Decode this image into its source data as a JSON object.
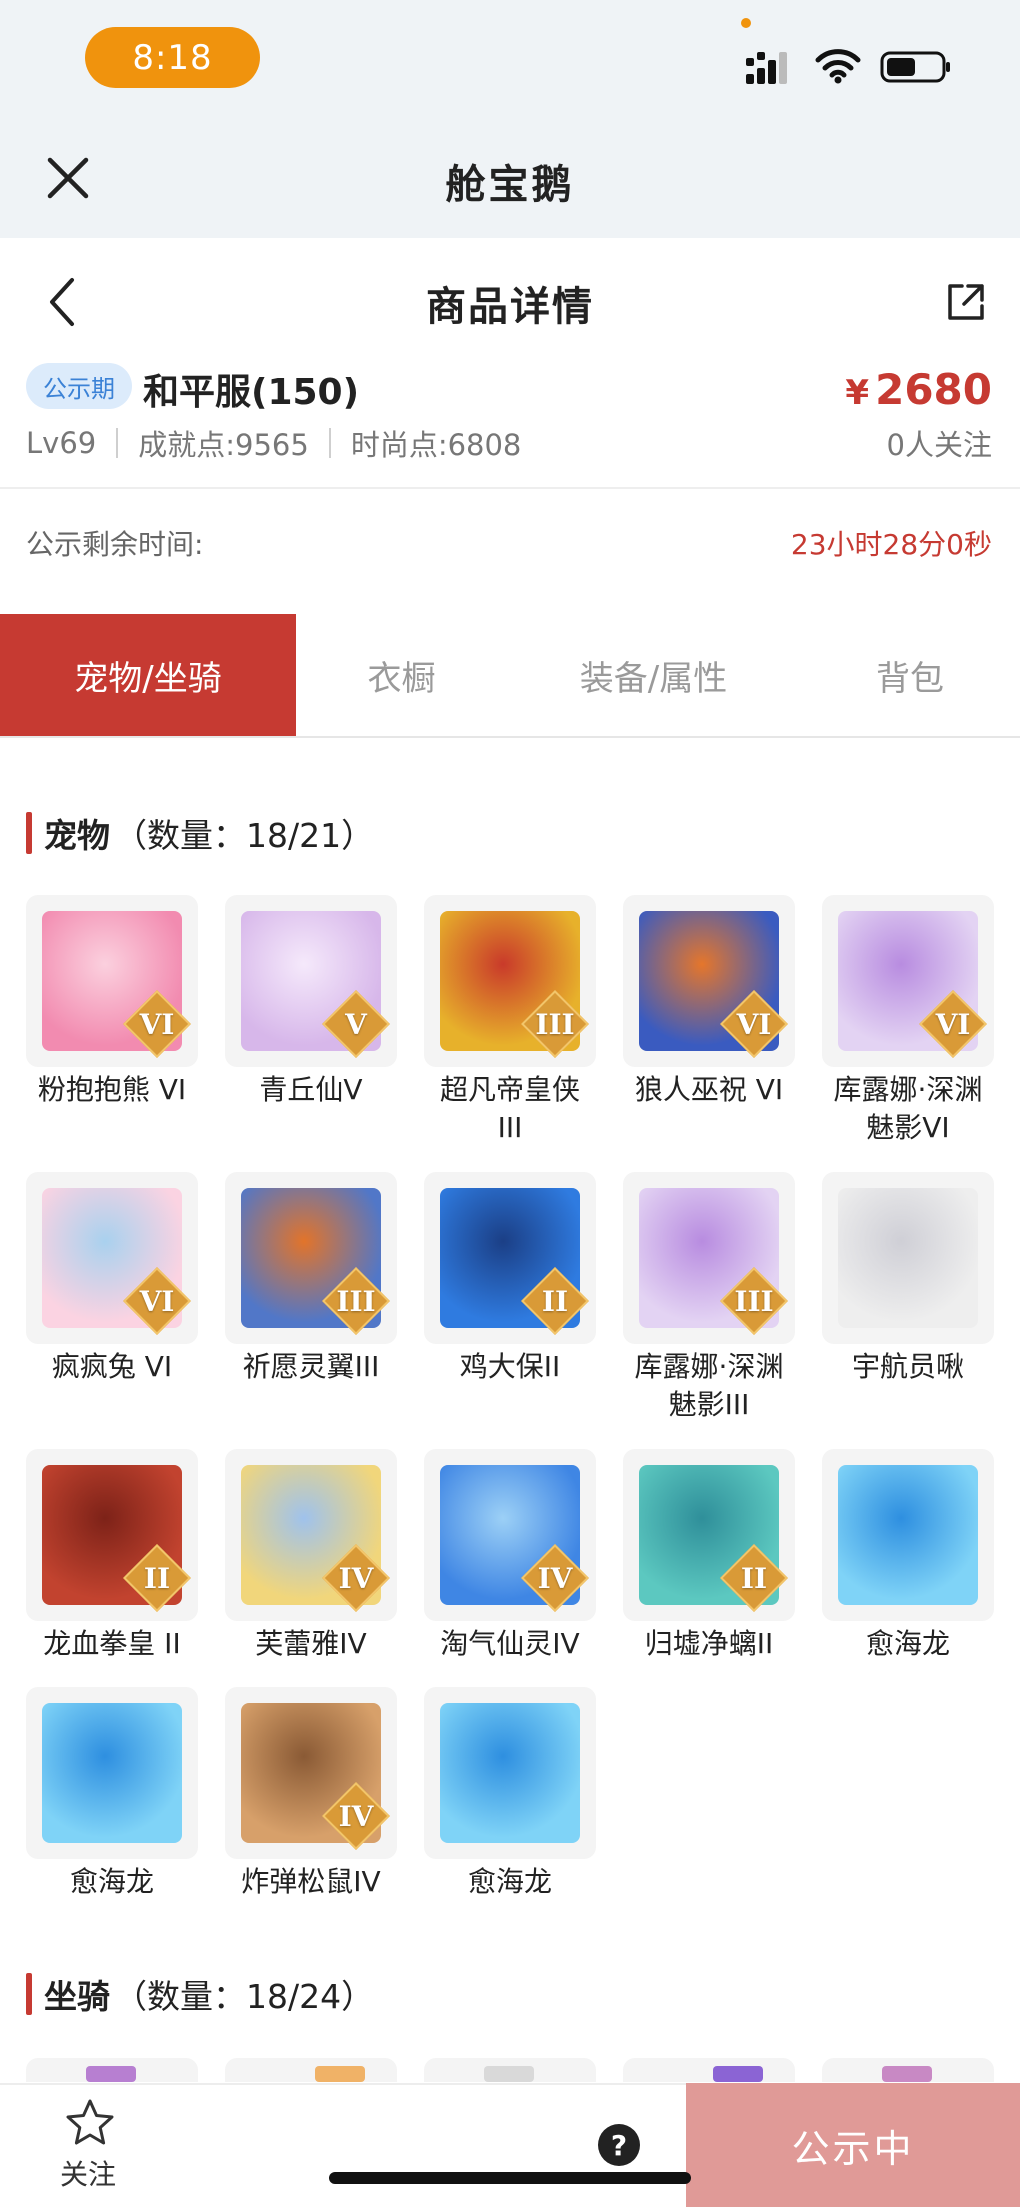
{
  "status_bar": {
    "time": "8:18"
  },
  "app": {
    "title": "舱宝鹅"
  },
  "nav": {
    "title": "商品详情"
  },
  "item": {
    "badge": "公示期",
    "server": "和平服(150)",
    "currency": "¥",
    "price": "2680",
    "level": "Lv69",
    "achievement": "成就点:9565",
    "fashion": "时尚点:6808",
    "followers": "0人关注"
  },
  "remaining": {
    "label": "公示剩余时间:",
    "value": "23小时28分0秒"
  },
  "tabs": [
    {
      "label": "宠物/坐骑"
    },
    {
      "label": "衣橱"
    },
    {
      "label": "装备/属性"
    },
    {
      "label": "背包"
    }
  ],
  "pets_section": {
    "name": "宠物",
    "count": "（数量：18/21）"
  },
  "pets": [
    {
      "label": "粉抱抱熊 VI",
      "rank": "VI",
      "colors": [
        "#f28bb0",
        "#fbd0de"
      ]
    },
    {
      "label": "青丘仙V",
      "rank": "V",
      "colors": [
        "#d7b7ea",
        "#f5e9fb"
      ]
    },
    {
      "label": "超凡帝皇侠\nIII",
      "rank": "III",
      "colors": [
        "#e7b12b",
        "#c93a2a"
      ]
    },
    {
      "label": "狼人巫祝 VI",
      "rank": "VI",
      "colors": [
        "#3a5bc0",
        "#e5762b"
      ]
    },
    {
      "label": "库露娜·深渊\n魅影VI",
      "rank": "VI",
      "colors": [
        "#e3d3f3",
        "#b88ce0"
      ]
    },
    {
      "label": "疯疯兔 VI",
      "rank": "VI",
      "colors": [
        "#fbd3e2",
        "#a9d1ee"
      ]
    },
    {
      "label": "祈愿灵翼III",
      "rank": "III",
      "colors": [
        "#5177c8",
        "#e2742a"
      ]
    },
    {
      "label": "鸡大保II",
      "rank": "II",
      "colors": [
        "#2f7be0",
        "#1b3f86"
      ]
    },
    {
      "label": "库露娜·深渊\n魅影III",
      "rank": "III",
      "colors": [
        "#e3d3f3",
        "#b88ce0"
      ]
    },
    {
      "label": "宇航员啾",
      "rank": "",
      "colors": [
        "#eeeeee",
        "#cfcfd6"
      ]
    },
    {
      "label": "龙血拳皇 II",
      "rank": "II",
      "colors": [
        "#c2432f",
        "#7d2218"
      ]
    },
    {
      "label": "芙蕾雅IV",
      "rank": "IV",
      "colors": [
        "#f1d67b",
        "#9fc2ec"
      ]
    },
    {
      "label": "淘气仙灵IV",
      "rank": "IV",
      "colors": [
        "#3f86e4",
        "#9cd0f6"
      ]
    },
    {
      "label": "归墟净螭II",
      "rank": "II",
      "colors": [
        "#5cc8c0",
        "#2f8f9a"
      ]
    },
    {
      "label": "愈海龙",
      "rank": "",
      "colors": [
        "#7fd3f7",
        "#2e8fe0"
      ]
    },
    {
      "label": "愈海龙",
      "rank": "",
      "colors": [
        "#7fd3f7",
        "#2e8fe0"
      ]
    },
    {
      "label": "炸弹松鼠IV",
      "rank": "IV",
      "colors": [
        "#d7a06a",
        "#8a5a35"
      ]
    },
    {
      "label": "愈海龙",
      "rank": "",
      "colors": [
        "#7fd3f7",
        "#2e8fe0"
      ]
    }
  ],
  "mounts_section": {
    "name": "坐骑",
    "count": "（数量：18/24）"
  },
  "mount_peek_colors": [
    "#b77fd1",
    "#f0b267",
    "#d9d9d9",
    "#8b64d4",
    "#c889c4"
  ],
  "bottom": {
    "follow_label": "关注",
    "help": "?",
    "status_button": "公示中"
  },
  "colors": {
    "accent": "#c63a32",
    "badge_bg": "#dcebfb",
    "time_pill": "#f0930d",
    "status_button": "#e09a97"
  }
}
